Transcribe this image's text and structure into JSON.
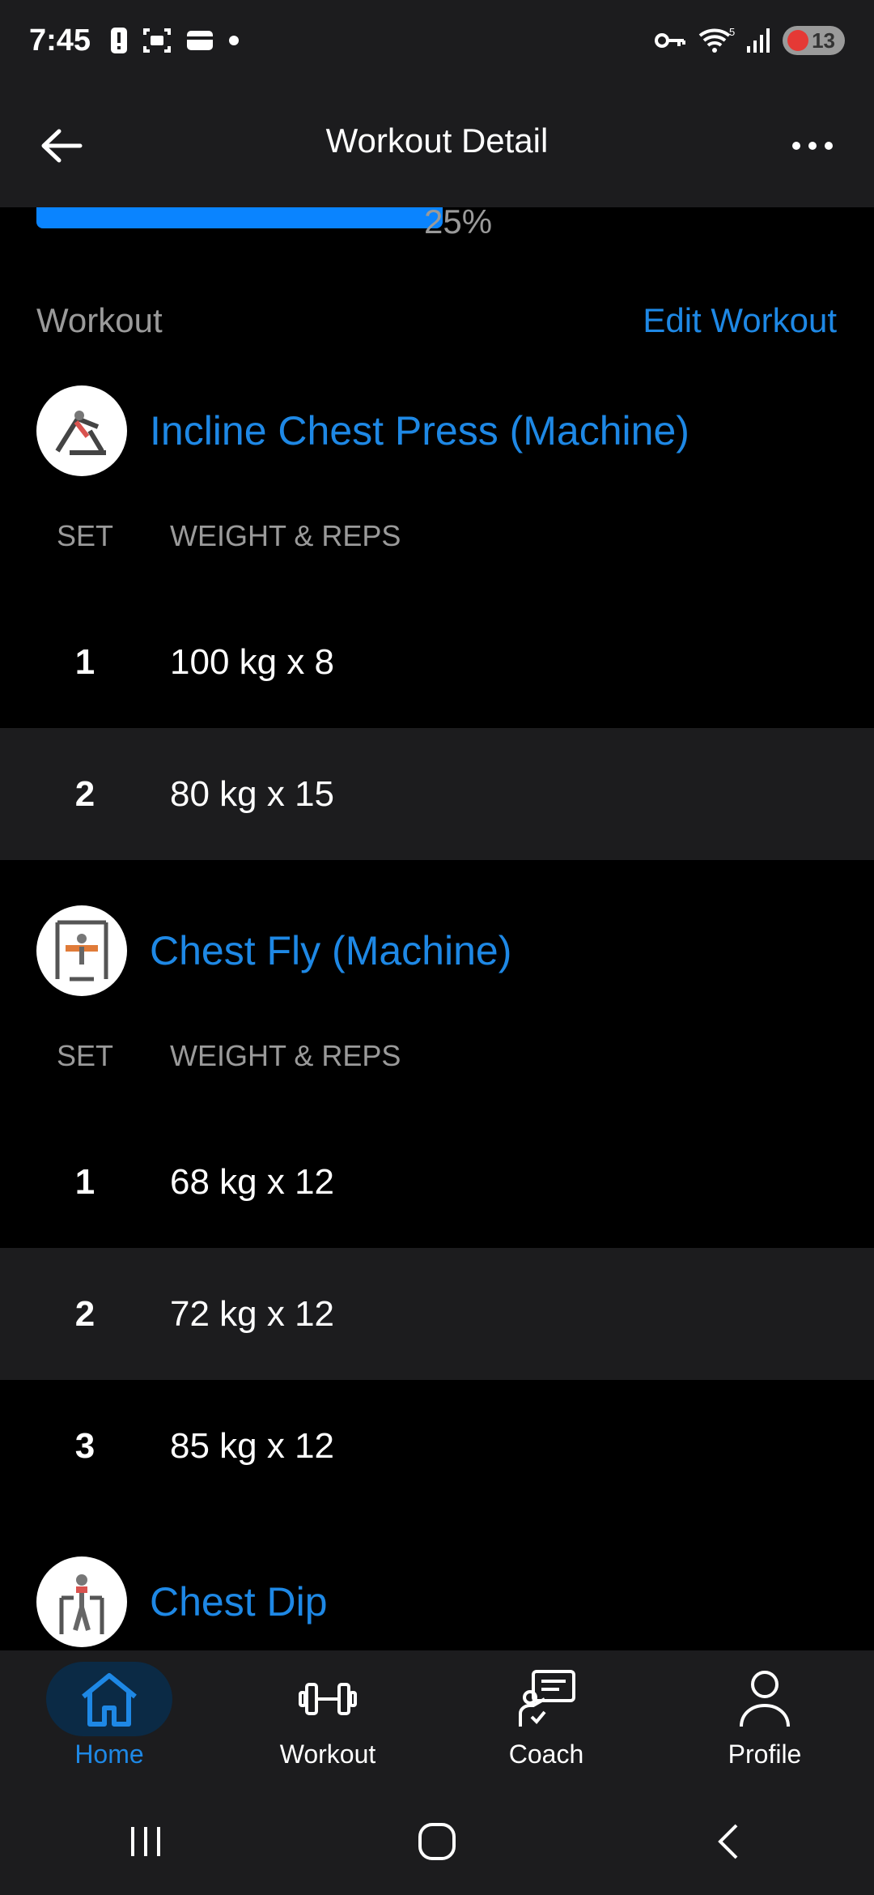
{
  "status_bar": {
    "time": "7:45",
    "battery_level": "13"
  },
  "app_bar": {
    "title": "Workout Detail"
  },
  "progress": {
    "fraction": 0.25,
    "label": "25%"
  },
  "section": {
    "label": "Workout",
    "edit_label": "Edit Workout"
  },
  "exercises": [
    {
      "name": "Incline Chest Press (Machine)",
      "col_set": "SET",
      "col_weight": "WEIGHT & REPS",
      "sets": [
        {
          "num": "1",
          "value": "100 kg x 8"
        },
        {
          "num": "2",
          "value": "80 kg x 15"
        }
      ]
    },
    {
      "name": "Chest Fly (Machine)",
      "col_set": "SET",
      "col_weight": "WEIGHT & REPS",
      "sets": [
        {
          "num": "1",
          "value": "68 kg x 12"
        },
        {
          "num": "2",
          "value": "72 kg x 12"
        },
        {
          "num": "3",
          "value": "85 kg x 12"
        }
      ]
    },
    {
      "name": "Chest Dip"
    }
  ],
  "bottom_nav": [
    {
      "label": "Home",
      "icon": "home-icon",
      "active": true
    },
    {
      "label": "Workout",
      "icon": "dumbbell-icon",
      "active": false
    },
    {
      "label": "Coach",
      "icon": "coach-icon",
      "active": false
    },
    {
      "label": "Profile",
      "icon": "person-icon",
      "active": false
    }
  ],
  "colors": {
    "accent": "#1e88e5",
    "progress": "#0a84ff",
    "surface": "#1c1c1e",
    "background": "#000000",
    "muted": "#9a9a9a"
  }
}
